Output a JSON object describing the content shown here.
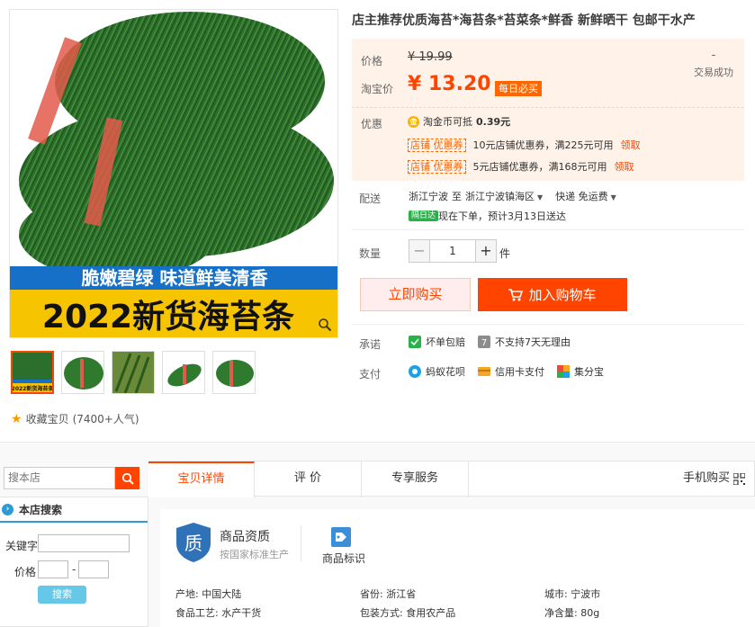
{
  "gallery": {
    "banner_line1": "脆嫩碧绿  味道鲜美清香",
    "banner_line2": "2022新货海苔条",
    "thumb_label": "2022新货海苔条",
    "favorite_label": "收藏宝贝",
    "favorite_count": "(7400+人气)"
  },
  "product": {
    "title": "店主推荐优质海苔*海苔条*苔菜条*鲜香 新鲜晒干 包邮干水产",
    "price_label": "价格",
    "original_price": "¥ 19.99",
    "taobao_price_label": "淘宝价",
    "taobao_price": "¥ 13.20",
    "daily_badge": "每日必买",
    "deal_count": "-",
    "deal_label": "交易成功",
    "discount_label": "优惠",
    "coin_text": "淘金币可抵",
    "coin_value": "0.39元",
    "coupon_tag": "店铺 优惠券",
    "coupon_get": "领取",
    "coupons": [
      {
        "text": "10元店铺优惠券，满225元可用"
      },
      {
        "text": "5元店铺优惠券，满168元可用"
      }
    ]
  },
  "shipping": {
    "label": "配送",
    "from": "浙江宁波",
    "to_word": "至",
    "to": "浙江宁波镇海区",
    "fee": "快递 免运费",
    "arrive_badge": "隔日达",
    "arrive_text": "现在下单，预计3月13日送达"
  },
  "quantity": {
    "label": "数量",
    "minus": "−",
    "value": "1",
    "plus": "+",
    "unit": "件"
  },
  "actions": {
    "buy_now": "立即购买",
    "add_cart": "加入购物车"
  },
  "services": {
    "promise_label": "承诺",
    "promise_items": [
      "坏单包赔",
      "不支持7天无理由"
    ],
    "pay_label": "支付",
    "pay_items": [
      "蚂蚁花呗",
      "信用卡支付",
      "集分宝"
    ]
  },
  "shop_search": {
    "placeholder": "搜本店",
    "panel_title": "本店搜索",
    "keyword_label": "关键字",
    "price_label": "价格",
    "dash": "-",
    "button": "搜索"
  },
  "tabs": {
    "items": [
      "宝贝详情",
      "评  价",
      "专享服务"
    ],
    "mobile": "手机购买"
  },
  "detail": {
    "qual_icon": "质",
    "qual_title": "商品资质",
    "qual_sub": "按国家标准生产",
    "tag_label": "商品标识",
    "attrs": [
      "产地: 中国大陆",
      "省份: 浙江省",
      "城市: 宁波市",
      "食品工艺: 水产干货",
      "包装方式: 食用农产品",
      "净含量: 80g"
    ]
  },
  "colors": {
    "accent": "#ff4400",
    "promo_bg": "#fff2e8",
    "seaweed": "#2f7a2e"
  }
}
